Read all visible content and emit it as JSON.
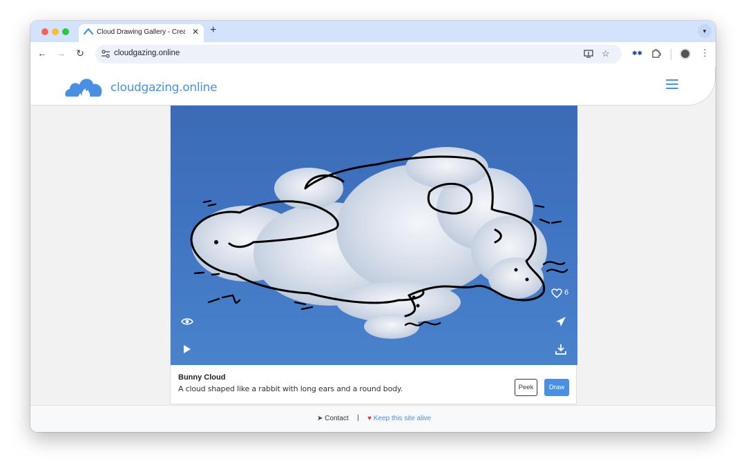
{
  "browser": {
    "tab_title": "Cloud Drawing Gallery - Crea",
    "url": "cloudgazing.online",
    "new_tab": "+",
    "close": "✕"
  },
  "site": {
    "brand": "cloudgazing.online"
  },
  "card": {
    "likes": "6",
    "title": "Bunny Cloud",
    "description": "A cloud shaped like a rabbit with long ears and a round body.",
    "peek_label": "Peek",
    "draw_label": "Draw"
  },
  "footer": {
    "contact": "Contact",
    "separator": "|",
    "support": "Keep this site alive"
  },
  "colors": {
    "accent": "#4a90e2",
    "sky": "#3f74c2",
    "heart": "#e53935"
  }
}
